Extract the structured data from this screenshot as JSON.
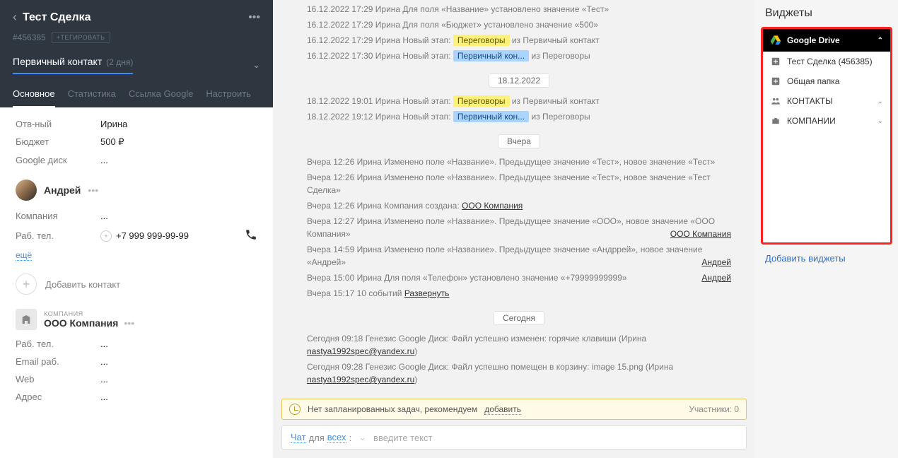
{
  "header": {
    "title": "Тест Сделка",
    "deal_id": "#456385",
    "tag_button": "+ТЕГИРОВАТЬ",
    "stage_name": "Первичный контакт",
    "stage_days": "(2 дня)"
  },
  "tabs": {
    "main": "Основное",
    "stats": "Статистика",
    "google": "Ссылка Google",
    "setup": "Настроить"
  },
  "fields": {
    "responsible_k": "Отв-ный",
    "responsible_v": "Ирина",
    "budget_k": "Бюджет",
    "budget_v": "500 ₽",
    "gdrive_k": "Google диск",
    "gdrive_v": "..."
  },
  "contact": {
    "name": "Андрей",
    "company_k": "Компания",
    "company_v": "...",
    "workphone_k": "Раб. тел.",
    "workphone_v": "+7 999 999-99-99",
    "more": "ещё",
    "add_contact": "Добавить контакт"
  },
  "company": {
    "label": "КОМПАНИЯ",
    "name": "ООО Компания",
    "workphone_k": "Раб. тел.",
    "email_k": "Email раб.",
    "web_k": "Web",
    "address_k": "Адрес"
  },
  "log": {
    "l1_ts": "16.12.2022 17:29",
    "l1_txt": "Ирина Для поля «Название» установлено значение «Тест»",
    "l2_ts": "16.12.2022 17:29",
    "l2_txt": "Ирина Для поля «Бюджет» установлено значение «500»",
    "l3_ts": "16.12.2022 17:29",
    "l3_pre": "Ирина Новый этап: ",
    "l3_badge": "Переговоры",
    "l3_post": " из Первичный контакт",
    "l4_ts": "16.12.2022 17:30",
    "l4_pre": "Ирина Новый этап: ",
    "l4_badge": "Первичный кон...",
    "l4_post": " из Переговоры",
    "date2": "18.12.2022",
    "l5_ts": "18.12.2022 19:01",
    "l5_pre": "Ирина Новый этап: ",
    "l5_badge": "Переговоры",
    "l5_post": " из Первичный контакт",
    "l6_ts": "18.12.2022 19:12",
    "l6_pre": "Ирина Новый этап: ",
    "l6_badge": "Первичный кон...",
    "l6_post": " из Переговоры",
    "date3": "Вчера",
    "y1": "Вчера 12:26 Ирина Изменено поле «Название». Предыдущее значение «Тест», новое значение «Тест»",
    "y2": "Вчера 12:26 Ирина Изменено поле «Название». Предыдущее значение «Тест», новое значение «Тест Сделка»",
    "y3_pre": "Вчера 12:26 Ирина Компания создана: ",
    "y3_link": "ООО Компания",
    "y4": "Вчера 12:27 Ирина Изменено поле «Название». Предыдущее значение «ООО», новое значение «ООО Компания»",
    "y4_r": "ООО Компания",
    "y5": "Вчера 14:59 Ирина Изменено поле «Название». Предыдущее значение «Андррей», новое значение «Андрей»",
    "y5_r": "Андрей",
    "y6": "Вчера 15:00 Ирина Для поля «Телефон» установлено значение «+79999999999»",
    "y6_r": "Андрей",
    "y7_pre": "Вчера 15:17 10 событий ",
    "y7_link": "Развернуть",
    "date4": "Сегодня",
    "t1_pre": "Сегодня 09:18 Генезис Google Диск: Файл успешно изменен: горячие клавиши (Ирина ",
    "t1_link": "nastya1992spec@yandex.ru",
    "t1_post": ")",
    "t2_pre": "Сегодня 09:28 Генезис Google Диск: Файл успешно помещен в корзину: image 15.png (Ирина ",
    "t2_link": "nastya1992spec@yandex.ru",
    "t2_post": ")"
  },
  "bottom": {
    "task_hint": "Нет запланированных задач, рекомендуем ",
    "task_add": "добавить",
    "participants": "Участники: 0",
    "chat": "Чат",
    "for": " для ",
    "all": "всех",
    "colon": ": ",
    "placeholder": "введите текст"
  },
  "widgets": {
    "title": "Виджеты",
    "gd_title": "Google Drive",
    "item1": "Тест Сделка (456385)",
    "item2": "Общая папка",
    "item3": "КОНТАКТЫ",
    "item4": "КОМПАНИИ",
    "add": "Добавить виджеты"
  }
}
